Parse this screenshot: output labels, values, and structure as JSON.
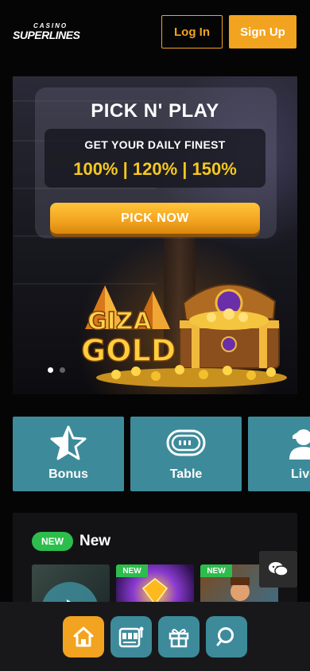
{
  "header": {
    "logo_top": "CASINO",
    "logo_main": "SUPERLINES",
    "login_label": "Log In",
    "signup_label": "Sign Up"
  },
  "banner": {
    "title": "PICK N' PLAY",
    "subtitle": "GET YOUR DAILY FINEST",
    "percentages": "100% | 120% | 150%",
    "cta_label": "PICK NOW",
    "game_logo": "GIZA GOLD",
    "slides": 2,
    "active_slide": 1
  },
  "categories": [
    {
      "label": "Bonus",
      "icon": "star-icon"
    },
    {
      "label": "Table",
      "icon": "chip-icon"
    },
    {
      "label": "Live",
      "icon": "dealer-icon"
    }
  ],
  "new_section": {
    "badge": "NEW",
    "title": "New",
    "thumb_tag": "NEW"
  },
  "bottom_nav": [
    {
      "name": "home",
      "icon": "home-icon",
      "active": true
    },
    {
      "name": "games",
      "icon": "slot-machine-icon",
      "active": false
    },
    {
      "name": "promotions",
      "icon": "gift-icon",
      "active": false
    },
    {
      "name": "search",
      "icon": "search-icon",
      "active": false
    }
  ],
  "colors": {
    "accent": "#f2a31f",
    "teal": "#3d8b9a",
    "new_badge": "#2dbd4c",
    "background": "#050505"
  }
}
